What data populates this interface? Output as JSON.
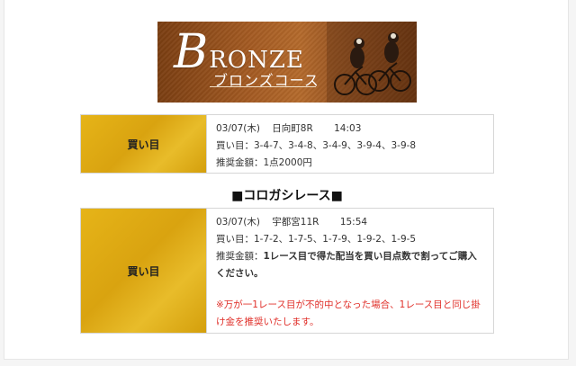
{
  "banner": {
    "title_initial": "B",
    "title_rest": "RONZE",
    "subtitle": "ブロンズコース"
  },
  "course1": {
    "label": "買い目",
    "date": "03/07(木)",
    "race": "日向町8R",
    "time": "14:03",
    "buy_line": "買い目：3-4-7、3-4-8、3-4-9、3-9-4、3-9-8",
    "amount_line": "推奨金額：1点2000円"
  },
  "section": {
    "heading": "■コロガシレース■"
  },
  "course2": {
    "label": "買い目",
    "date": "03/07(木)",
    "race": "宇都宮11R",
    "time": "15:54",
    "buy_line": "買い目：1-7-2、1-7-5、1-7-9、1-9-2、1-9-5",
    "amount_prefix": "推奨金額：",
    "amount_bold": "1レース目で得た配当を買い目点数で割ってご購入ください。",
    "note": "※万が一1レース目が不的中となった場合、1レース目と同じ掛け金を推奨いたします。"
  },
  "colors": {
    "gold": "#d9a310",
    "bronze": "#a35a22",
    "note_red": "#e0302a"
  }
}
